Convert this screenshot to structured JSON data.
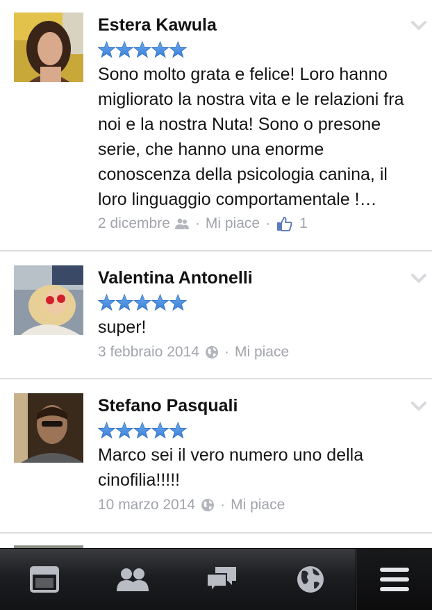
{
  "reviews": [
    {
      "name": "Estera Kawula",
      "rating": 5,
      "text": "Sono molto grata e felice! Loro hanno migliorato la nostra vita e le relazioni fra noi e la nostra Nuta! Sono o presone serie, che hanno una enorme conoscenza della psicologia canina, il loro linguaggio comportamentale !…",
      "date": "2 dicembre",
      "privacy_icon": "friends-icon",
      "like_label": "Mi piace",
      "like_count": "1"
    },
    {
      "name": "Valentina Antonelli",
      "rating": 5,
      "text": "super!",
      "date": "3 febbraio 2014",
      "privacy_icon": "globe-icon",
      "like_label": "Mi piace"
    },
    {
      "name": "Stefano Pasquali",
      "rating": 5,
      "text": "Marco sei il vero numero uno della cinofilia!!!!!",
      "date": "10 marzo 2014",
      "privacy_icon": "globe-icon",
      "like_label": "Mi piace"
    }
  ],
  "separator": "·",
  "colors": {
    "star": "#4a90e2",
    "meta_text": "#a1a4ab",
    "tabbar_bg": "#1c1d20",
    "tab_icon": "#b9bcc2"
  },
  "tabbar": {
    "tabs": [
      {
        "icon": "news-feed-icon"
      },
      {
        "icon": "friend-requests-icon"
      },
      {
        "icon": "messages-icon"
      },
      {
        "icon": "notifications-globe-icon"
      },
      {
        "icon": "menu-icon",
        "active": true
      }
    ]
  }
}
